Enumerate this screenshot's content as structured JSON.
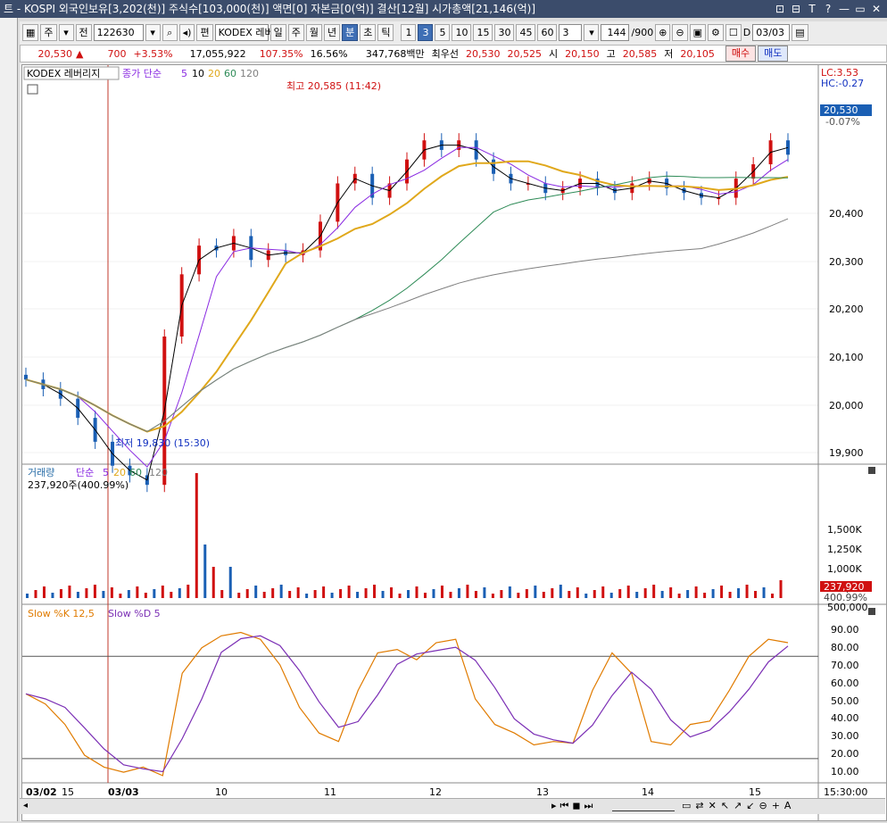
{
  "titlebar": {
    "text": "트 - KOSPI 외국인보유[3,202(천)] 주식수[103,000(천)] 액면[0] 자본금[0(억)] 결산[12월] 시가총액[21,146(억)]",
    "buttons": [
      "⊡",
      "⊟",
      "T",
      "?",
      "—",
      "▭",
      "✕"
    ]
  },
  "toolbar": {
    "period": "주",
    "kind": "전",
    "code": "122630",
    "name": "KODEX 레버",
    "periods": [
      "일",
      "주",
      "월",
      "년",
      "분",
      "초",
      "틱"
    ],
    "selected_period": "분",
    "minutes": [
      "1",
      "3",
      "5",
      "10",
      "15",
      "30",
      "45",
      "60"
    ],
    "selected_minute": "3",
    "interval_value": "3",
    "count": "144",
    "count_total": "/900",
    "date_prefix": "D",
    "date": "03/03"
  },
  "quote": {
    "price": "20,530",
    "arrow": "▲",
    "change": "700",
    "change_pct": "+3.53%",
    "volume": "17,055,922",
    "vol_ratio": "107.35%",
    "turnover": "16.56%",
    "amount": "347,768백만",
    "best_label": "최우선",
    "best_ask": "20,530",
    "best_bid": "20,525",
    "open_label": "시",
    "open": "20,150",
    "high_label": "고",
    "high": "20,585",
    "low_label": "저",
    "low": "20,105",
    "buy": "매수",
    "sell": "매도"
  },
  "price_panel": {
    "name": "KODEX 레버리지",
    "ma_label": "종가 단순",
    "ma_periods": [
      "5",
      "10",
      "20",
      "60",
      "120"
    ],
    "lc": "LC:3.53",
    "hc": "HC:-0.27",
    "last_price": "20,530",
    "last_pct": "-0.07%",
    "y_ticks": [
      "20,400",
      "20,300",
      "20,200",
      "20,100",
      "20,000",
      "19,900"
    ],
    "high_note": "최고 20,585 (11:42)",
    "low_note": "최저 19,830 (15:30)"
  },
  "volume_panel": {
    "label": "거래량",
    "ma_label": "단순",
    "ma_periods": [
      "5",
      "20",
      "60",
      "120"
    ],
    "current": "237,920주(400.99%)",
    "y_ticks": [
      "1,500K",
      "1,250K",
      "1,000K",
      "750,000",
      "500,000"
    ],
    "tag_value": "237,920",
    "tag_pct": "400.99%"
  },
  "stoch_panel": {
    "k_label": "Slow %K 12,5",
    "d_label": "Slow %D 5",
    "y_ticks": [
      "90.00",
      "80.00",
      "70.00",
      "60.00",
      "50.00",
      "40.00",
      "30.00",
      "20.00",
      "10.00"
    ]
  },
  "x_axis": {
    "labels": [
      "03/02",
      "15",
      "03/03",
      "10",
      "11",
      "12",
      "13",
      "14",
      "15"
    ],
    "time": "15:30:00"
  },
  "colors": {
    "up": "#d01010",
    "down": "#1a5fb4",
    "ma5": "#000000",
    "ma10": "#8a2be2",
    "ma20": "#e0a81b",
    "ma60": "#2e8b57",
    "ma120": "#808080"
  },
  "chart_data": {
    "type": "candlestick",
    "y_range": [
      19830,
      20585
    ],
    "close_sketch": [
      20060,
      20040,
      20020,
      19980,
      19930,
      19880,
      19860,
      19840,
      20150,
      20280,
      20340,
      20330,
      20360,
      20310,
      20330,
      20320,
      20330,
      20390,
      20470,
      20490,
      20440,
      20470,
      20520,
      20560,
      20540,
      20560,
      20520,
      20490,
      20470,
      20470,
      20450,
      20460,
      20480,
      20460,
      20450,
      20470,
      20480,
      20460,
      20450,
      20440,
      20440,
      20480,
      20510,
      20560,
      20530
    ],
    "stoch_k": [
      58,
      52,
      40,
      22,
      15,
      12,
      15,
      10,
      70,
      85,
      92,
      94,
      90,
      75,
      50,
      35,
      30,
      60,
      82,
      84,
      78,
      88,
      90,
      55,
      40,
      35,
      28,
      30,
      29,
      60,
      82,
      70,
      30,
      28,
      40,
      42,
      60,
      80,
      90,
      88
    ]
  }
}
